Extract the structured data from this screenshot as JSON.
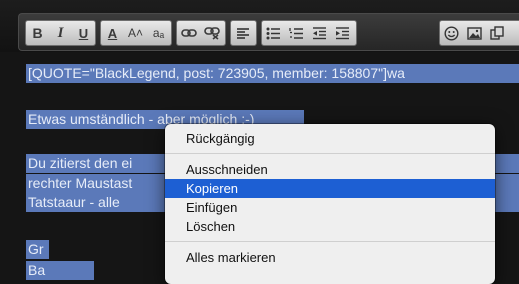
{
  "toolbar": {
    "groups": [
      [
        "bold-icon",
        "italic-icon",
        "underline-icon"
      ],
      [
        "font-color-icon",
        "font-size-icon",
        "font-case-icon"
      ],
      [
        "link-icon",
        "unlink-icon"
      ],
      [
        "align-left-icon"
      ],
      [
        "bullet-list-icon",
        "numbered-list-icon",
        "outdent-icon",
        "indent-icon"
      ],
      [
        "smiley-icon",
        "image-icon",
        "media-icon"
      ]
    ],
    "glyphs": {
      "bold": "B",
      "italic": "I",
      "underline": "U",
      "font_color": "A",
      "font_size": "A˄",
      "font_case": "aₐ"
    }
  },
  "editor": {
    "lines": [
      "[QUOTE=\"BlackLegend, post: 723905, member: 158807\"]wa",
      "Etwas umständlich - aber möglich :-)",
      "Du zitierst den ei",
      "rechter Maustast",
      "Tatstaaur - alle",
      "Gr",
      "Ba"
    ]
  },
  "context_menu": {
    "items": [
      "Rückgängig",
      "Ausschneiden",
      "Kopieren",
      "Einfügen",
      "Löschen",
      "Alles markieren"
    ],
    "highlighted": "Kopieren"
  },
  "colors": {
    "selection": "#5b79b9",
    "menu_highlight": "#1d5fd3"
  }
}
